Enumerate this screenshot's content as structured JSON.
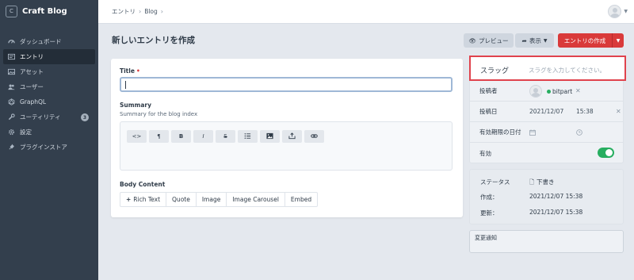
{
  "app": {
    "name": "Craft Blog",
    "logo_letter": "C"
  },
  "sidebar": {
    "items": [
      {
        "label": "ダッシュボード",
        "icon": "dashboard-icon"
      },
      {
        "label": "エントリ",
        "icon": "entries-icon",
        "active": true
      },
      {
        "label": "アセット",
        "icon": "image-icon"
      },
      {
        "label": "ユーザー",
        "icon": "users-icon"
      },
      {
        "label": "GraphQL",
        "icon": "graphql-icon"
      },
      {
        "label": "ユーティリティ",
        "icon": "wrench-icon",
        "badge": "3"
      },
      {
        "label": "設定",
        "icon": "gear-icon"
      },
      {
        "label": "プラグインストア",
        "icon": "plug-icon"
      }
    ]
  },
  "breadcrumb": {
    "items": [
      "エントリ",
      "Blog"
    ],
    "sep": "›"
  },
  "header": {
    "title": "新しいエントリを作成",
    "preview_label": "プレビュー",
    "view_label": "表示",
    "create_label": "エントリの作成"
  },
  "form": {
    "title_label": "Title",
    "title_required": "•",
    "summary_label": "Summary",
    "summary_instructions": "Summary for the blog index",
    "toolbar": [
      "<>",
      "¶",
      "B",
      "I",
      "S",
      "list",
      "image",
      "upload",
      "link"
    ],
    "body_label": "Body Content",
    "matrix_add_label": "Rich Text",
    "matrix_blocks": [
      "Quote",
      "Image",
      "Image Carousel",
      "Embed"
    ]
  },
  "meta": {
    "slug_label": "スラッグ",
    "slug_placeholder": "スラグを入力してください。",
    "author_label": "投稿者",
    "author_name": "bitpart",
    "post_date_label": "投稿日",
    "post_date": "2021/12/07",
    "post_time": "15:38",
    "expiry_label": "有効期限の日付",
    "enabled_label": "有効",
    "enabled": true
  },
  "status": {
    "status_label": "ステータス",
    "status_value": "下書き",
    "created_label": "作成：",
    "created_value": "2021/12/07 15:38",
    "updated_label": "更新：",
    "updated_value": "2021/12/07 15:38"
  },
  "notes": {
    "placeholder": "変更通知"
  },
  "colors": {
    "sidebar": "#333f4d",
    "accent_red": "#d93a3a",
    "toggle_green": "#27ae60",
    "highlight_border": "#e0434d"
  }
}
